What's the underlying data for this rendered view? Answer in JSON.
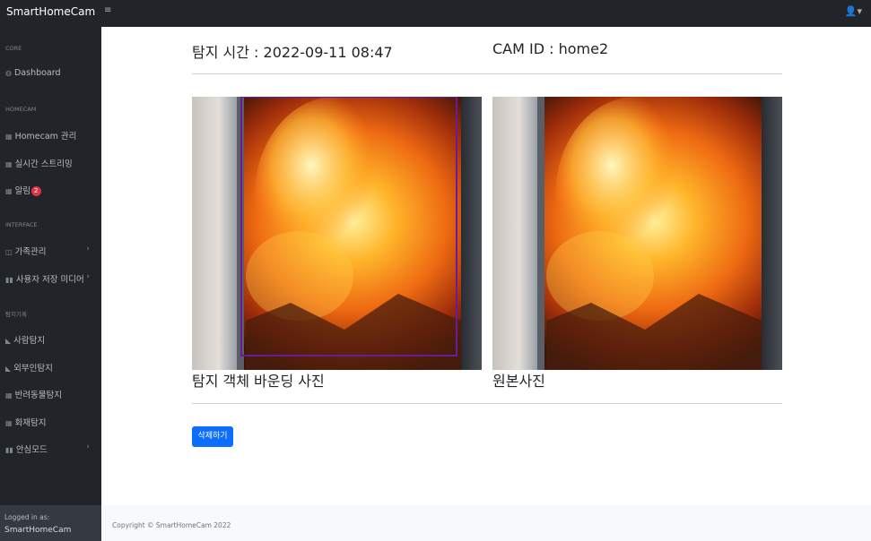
{
  "app": {
    "brand": "SmartHomeCam",
    "toggle_icon": "≡",
    "user_icon": "👤▾"
  },
  "sidebar": {
    "headings": {
      "core": "CORE",
      "homecam": "HOMECAM",
      "interface": "INTERFACE",
      "detect": "탐지기록"
    },
    "items": {
      "dashboard": "Dashboard",
      "homecam_manage": "Homecam 관리",
      "live_stream": "실시간 스트리밍",
      "alerts": "알림",
      "alerts_badge": "2",
      "family": "가족관리",
      "user_media": "사용자 저장 미디어",
      "person": "사람탐지",
      "outsider": "외부인탐지",
      "pet": "반려동물탐지",
      "fire": "화재탐지",
      "safe_mode": "안심모드"
    },
    "footer": {
      "label": "Logged in as:",
      "user": "SmartHomeCam"
    }
  },
  "detail": {
    "time_label": "탐지 시간 : 2022-09-11 08:47",
    "cam_label": "CAM ID : home2",
    "caption_bbox": "탐지 객체 바운딩 사진",
    "caption_original": "원본사진",
    "delete_button": "삭제하기"
  },
  "footer": {
    "copyright": "Copyright © SmartHomeCam 2022"
  },
  "colors": {
    "sidebar_bg": "#212529",
    "primary": "#0d6efd",
    "badge": "#dc3545",
    "bbox": "#6a1b9a"
  }
}
